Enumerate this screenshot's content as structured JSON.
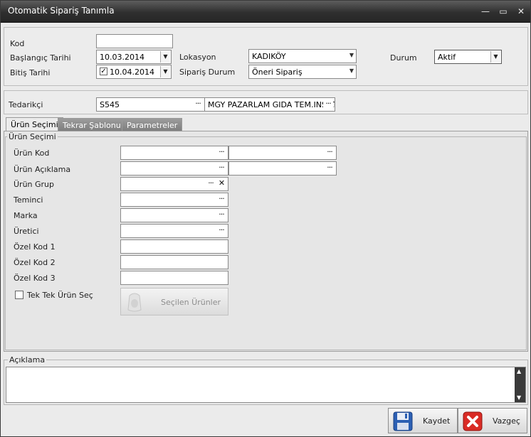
{
  "window": {
    "title": "Otomatik Sipariş Tanımla",
    "min": "—",
    "max": "▭",
    "close": "✕"
  },
  "header": {
    "kod_label": "Kod",
    "kod_value": "",
    "baslangic_label": "Başlangıç Tarihi",
    "baslangic_value": "10.03.2014",
    "bitis_label": "Bitiş Tarihi",
    "bitis_value": "10.04.2014",
    "bitis_checked": "✓",
    "lokasyon_label": "Lokasyon",
    "lokasyon_value": "KADIKÖY",
    "siparis_durum_label": "Sipariş Durum",
    "siparis_durum_value": "Öneri Sipariş",
    "durum_label": "Durum",
    "durum_value": "Aktif"
  },
  "tedarikci": {
    "label": "Tedarikçi",
    "code": "S545",
    "name": "MGY PAZARLAM GIDA TEM.INS.LT"
  },
  "tabs": [
    {
      "label": "Ürün Seçimi"
    },
    {
      "label": "Tekrar Şablonu"
    },
    {
      "label": "Parametreler"
    }
  ],
  "urun_secimi": {
    "group_title": "Ürün Seçimi",
    "fields": [
      {
        "label": "Ürün Kod"
      },
      {
        "label": "Ürün Açıklama"
      },
      {
        "label": "Ürün Grup"
      },
      {
        "label": "Teminci"
      },
      {
        "label": "Marka"
      },
      {
        "label": "Üretici"
      },
      {
        "label": "Özel Kod 1"
      },
      {
        "label": "Özel Kod 2"
      },
      {
        "label": "Özel Kod 3"
      }
    ],
    "tek_tek_label": "Tek Tek Ürün Seç",
    "secilen_button": "Seçilen Ürünler"
  },
  "aciklama": {
    "title": "Açıklama",
    "value": ""
  },
  "buttons": {
    "kaydet": "Kaydet",
    "vazgec": "Vazgeç"
  },
  "glyphs": {
    "dots": "···",
    "clear": "✕",
    "down": "▼"
  }
}
